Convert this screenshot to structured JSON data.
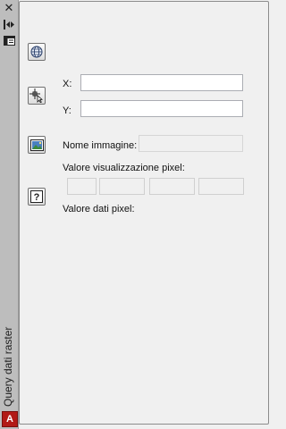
{
  "palette": {
    "title": "Query dati raster",
    "logo_letter": "A"
  },
  "fields": {
    "x_label": "X:",
    "x_value": "",
    "y_label": "Y:",
    "y_value": "",
    "image_name_label": "Nome immagine:",
    "image_name_value": "",
    "pixel_display_label": "Valore visualizzazione pixel:",
    "pixel_data_label": "Valore dati pixel:"
  },
  "icons": {
    "close": "close-icon",
    "pin": "auto-hide-icon",
    "properties": "properties-icon",
    "globe": "globe-icon",
    "pick_point": "pick-point-icon",
    "image": "raster-image-icon",
    "help": "help-icon"
  }
}
